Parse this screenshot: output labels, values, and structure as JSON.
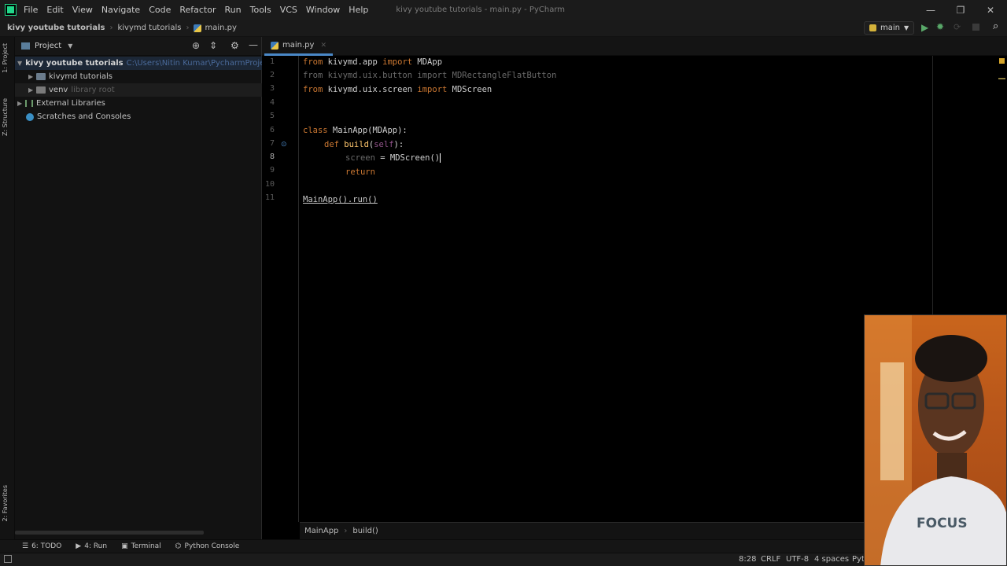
{
  "menu": [
    "File",
    "Edit",
    "View",
    "Navigate",
    "Code",
    "Refactor",
    "Run",
    "Tools",
    "VCS",
    "Window",
    "Help"
  ],
  "window_title": "kivy youtube tutorials - main.py - PyCharm",
  "window_controls": {
    "minimize": "—",
    "maximize": "❐",
    "close": "✕"
  },
  "breadcrumbs": {
    "project": "kivy youtube tutorials",
    "folder": "kivymd tutorials",
    "file": "main.py"
  },
  "run_config": {
    "label": "main"
  },
  "left_stripe": {
    "project_tab": "1: Project",
    "structure_tab": "Z: Structure",
    "favorites_tab": "2: Favorites"
  },
  "project_panel": {
    "title": "Project",
    "root": {
      "name": "kivy youtube tutorials",
      "path": "C:\\Users\\Nitin Kumar\\PycharmProjects\\k"
    },
    "children": [
      {
        "name": "kivymd tutorials",
        "hint": ""
      },
      {
        "name": "venv",
        "hint": "library root"
      }
    ],
    "external": "External Libraries",
    "scratches": "Scratches and Consoles"
  },
  "editor": {
    "tab_label": "main.py",
    "line_numbers": [
      "1",
      "2",
      "3",
      "4",
      "5",
      "6",
      "7",
      "8",
      "9",
      "10",
      "11"
    ],
    "lines": {
      "l1": {
        "a": "from",
        "b": " kivymd.app ",
        "c": "import",
        "d": " MDApp"
      },
      "l2": {
        "a": "from kivymd.uix.button import MDRectangleFlatButton"
      },
      "l3": {
        "a": "from",
        "b": " kivymd.uix.screen ",
        "c": "import",
        "d": " MDScreen"
      },
      "l6": {
        "a": "class",
        "b": " MainApp(MDApp):"
      },
      "l7": {
        "a": "def",
        "b": " build",
        "c": "(",
        "d": "self",
        "e": "):"
      },
      "l8": {
        "a": "screen",
        "b": " = MDScreen()"
      },
      "l9": {
        "a": "return"
      },
      "l11": {
        "a": "MainApp().run()"
      }
    },
    "crumbs": {
      "class": "MainApp",
      "method": "build()"
    }
  },
  "bottom_tools": [
    "6: TODO",
    "4: Run",
    "Terminal",
    "Python Console"
  ],
  "status": {
    "position": "8:28",
    "line_sep": "CRLF",
    "encoding": "UTF-8",
    "indent": "4 spaces",
    "interpreter": "Pyth"
  },
  "colors": {
    "keyword": "#cc7832",
    "function": "#ffc66d",
    "tab_accent": "#4a88c7",
    "run_green": "#59a869"
  }
}
